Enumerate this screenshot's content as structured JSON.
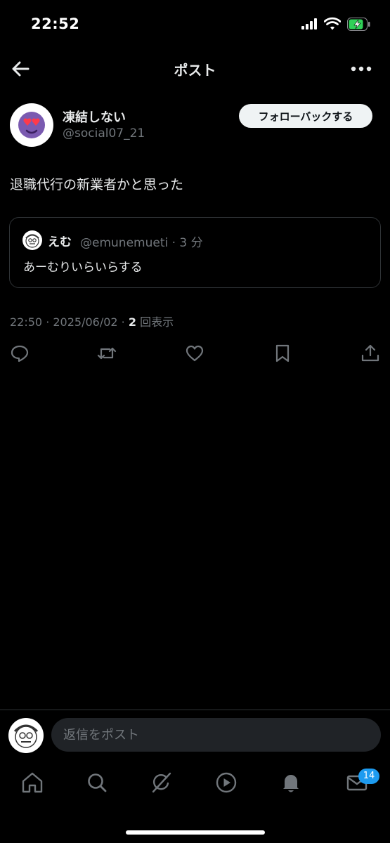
{
  "status_bar": {
    "time": "22:52"
  },
  "nav": {
    "title": "ポスト"
  },
  "post": {
    "author": {
      "name": "凍結しない",
      "handle": "@social07_21"
    },
    "follow_label": "フォローバックする",
    "text": "退職代行の新業者かと思った",
    "quote": {
      "name": "えむ",
      "handle": "@emunemueti · 3 分",
      "text": "あーむりいらいらする"
    },
    "meta": {
      "time_date": "22:50 · 2025/06/02 · ",
      "view_count": "2",
      "view_label": " 回表示"
    }
  },
  "actions": [
    "reply-icon",
    "repost-icon",
    "like-icon",
    "bookmark-icon",
    "share-icon"
  ],
  "reply": {
    "placeholder": "返信をポスト"
  },
  "tabs": [
    "home-icon",
    "search-icon",
    "grok-icon",
    "video-icon",
    "notifications-icon",
    "messages-icon"
  ],
  "messages_badge": "14",
  "colors": {
    "background": "#000000",
    "text": "#e7e9ea",
    "secondary": "#71767b",
    "accent": "#1d9bf0",
    "battery": "#30d158"
  }
}
